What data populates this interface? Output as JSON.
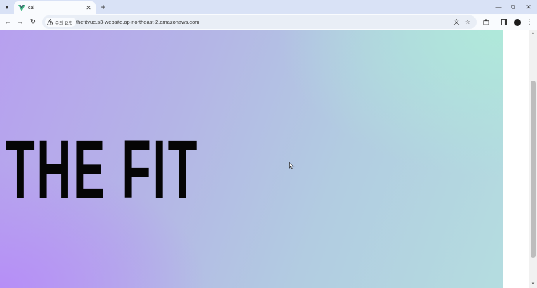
{
  "browser": {
    "tab": {
      "title": "cal",
      "favicon": "vue-logo-icon"
    },
    "address_bar": {
      "security_label": "주의 요함",
      "url": "thefitvue.s3-website.ap-northeast-2.amazonaws.com"
    },
    "icons": {
      "tab_list": "chevron-down-icon",
      "new_tab": "plus-icon",
      "back": "back-arrow-icon",
      "forward": "forward-arrow-icon",
      "reload": "reload-icon",
      "translate": "translate-icon",
      "bookmark": "star-icon",
      "extensions": "puzzle-icon",
      "side_panel": "side-panel-icon",
      "menu": "kebab-menu-icon"
    }
  },
  "page": {
    "hero_title": "THE FIT",
    "colors": {
      "gradient_purple": "#b68ef7",
      "gradient_mint": "#afe9da",
      "title_color": "#050505"
    }
  }
}
